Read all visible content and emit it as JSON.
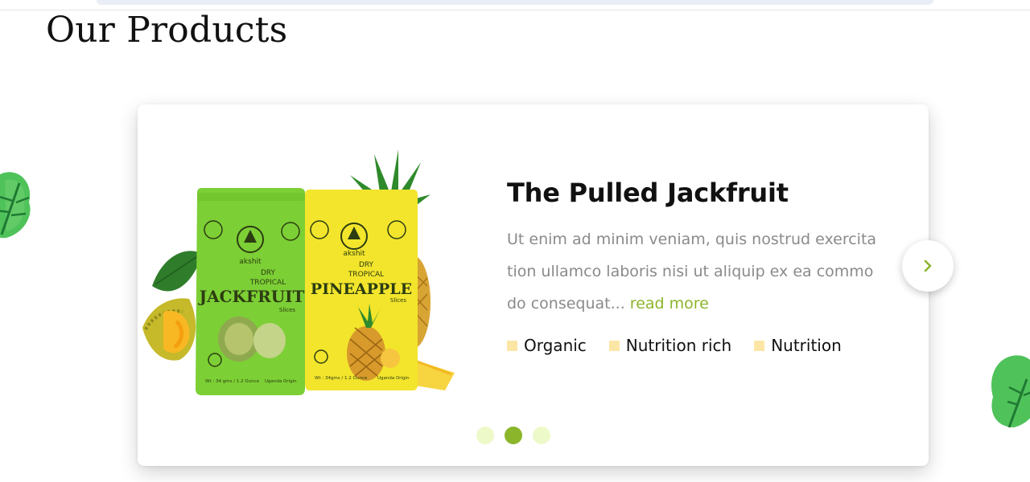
{
  "section": {
    "title": "Our Products"
  },
  "product": {
    "title": "The Pulled Jackfruit",
    "description": "Ut enim ad minim veniam, quis nostrud exercitation ullamco laboris nisi ut aliquip ex ea commodo consequat...",
    "read_more": "read more",
    "features": [
      "Organic",
      "Nutrition rich",
      "Nutrition"
    ],
    "packages": [
      {
        "brand": "akshit",
        "line1": "DRY",
        "line2": "TROPICAL",
        "name": "JACKFRUIT",
        "sub": "Slices",
        "weight": "Wt : 34 gms / 1.2 Ounce",
        "origin": "Uganda Origin",
        "color": "#7ccf35"
      },
      {
        "brand": "akshit",
        "line1": "DRY",
        "line2": "TROPICAL",
        "name": "PINEAPPLE",
        "sub": "Slices",
        "weight": "Wt : 34gms / 1.2 Ounce",
        "origin": "Uganda Origin",
        "color": "#f3e52c"
      }
    ]
  },
  "carousel": {
    "active_index": 1,
    "count": 3
  },
  "icons": {
    "next": "chevron-right-icon",
    "leaf": "leaf-icon"
  },
  "colors": {
    "accent": "#8bb52a",
    "bullet": "#fbe6a6",
    "dot_inactive": "#edf9c8"
  }
}
